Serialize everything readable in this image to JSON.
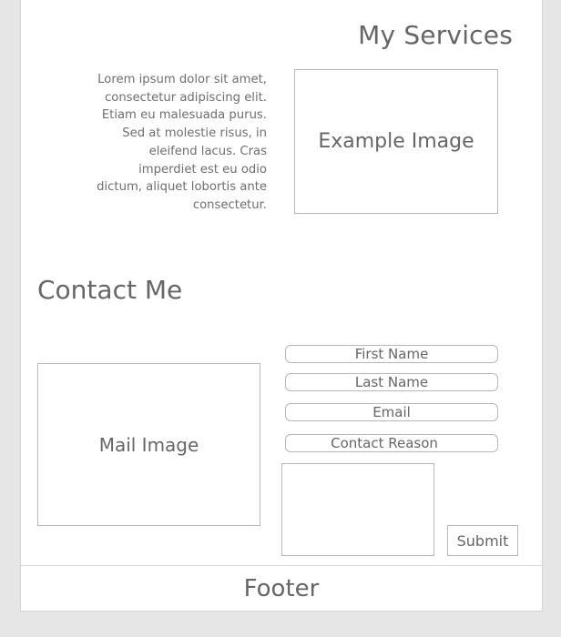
{
  "services": {
    "title": "My Services",
    "text": "Lorem ipsum dolor sit amet, consectetur adipiscing elit. Etiam eu malesuada purus. Sed at molestie risus, in eleifend lacus. Cras imperdiet est eu odio dictum, aliquet lobortis ante consectetur.",
    "image_label": "Example Image"
  },
  "contact": {
    "title": "Contact Me",
    "image_label": "Mail Image",
    "fields": {
      "first_name": "First Name",
      "last_name": "Last Name",
      "email": "Email",
      "reason": "Contact Reason"
    },
    "message": "",
    "submit_label": "Submit"
  },
  "footer": {
    "label": "Footer"
  }
}
